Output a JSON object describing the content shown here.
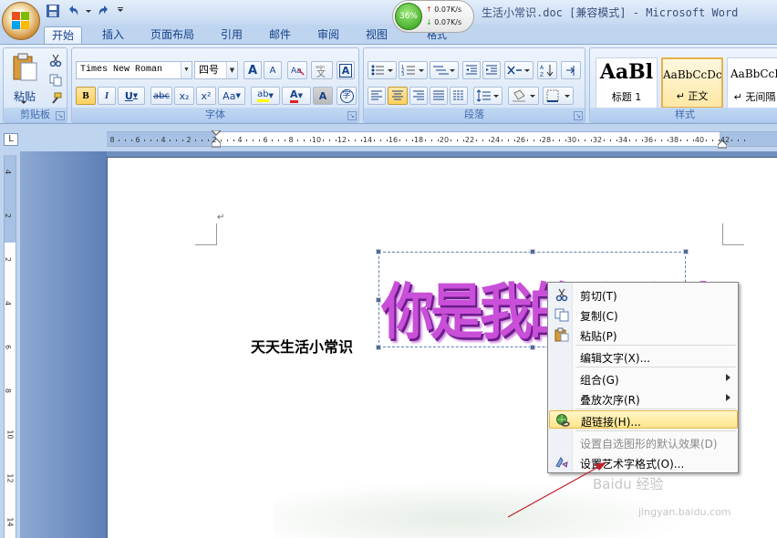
{
  "window": {
    "title": "生活小常识.doc [兼容模式] - Microsoft Word"
  },
  "network": {
    "cpu_percent": "36%",
    "upload": "0.07K/s",
    "download": "0.07K/s"
  },
  "tabs": [
    {
      "label": "开始"
    },
    {
      "label": "插入"
    },
    {
      "label": "页面布局"
    },
    {
      "label": "引用"
    },
    {
      "label": "邮件"
    },
    {
      "label": "审阅"
    },
    {
      "label": "视图"
    },
    {
      "label": "格式"
    }
  ],
  "ribbon": {
    "clipboard": {
      "paste_label": "粘贴",
      "group_label": "剪贴板"
    },
    "font": {
      "font_name": "Times New Roman",
      "font_size": "四号",
      "group_label": "字体",
      "grow": "A",
      "shrink": "A",
      "bold": "B",
      "italic": "I",
      "underline": "U",
      "strike": "abc",
      "subscript": "x₂",
      "superscript": "x²",
      "case": "Aa",
      "highlight": "ab",
      "font_color": "A",
      "char_shade": "A",
      "enclose": "字"
    },
    "paragraph": {
      "group_label": "段落"
    },
    "styles": {
      "group_label": "样式",
      "items": [
        {
          "preview": "AaBl",
          "name": "标题 1"
        },
        {
          "preview": "AaBbCcDc",
          "name": "↵ 正文"
        },
        {
          "preview": "AaBbCcI",
          "name": "↵ 无间隔"
        }
      ]
    }
  },
  "ruler": {
    "h_ticks": [
      "8",
      "6",
      "4",
      "2",
      "2",
      "4",
      "6",
      "8",
      "10",
      "12",
      "14",
      "16",
      "18",
      "20",
      "22",
      "24",
      "26",
      "28",
      "30",
      "32",
      "34",
      "36",
      "38",
      "40",
      "42"
    ],
    "v_ticks": [
      "4",
      "2",
      "2",
      "4",
      "6",
      "8",
      "10",
      "12",
      "14"
    ]
  },
  "document": {
    "body_text": "天天生活小常识",
    "wordart_text": "你是我的小小人",
    "para_mark": "↵"
  },
  "context_menu": {
    "items": [
      {
        "label": "剪切(T)",
        "icon": "scissors-icon"
      },
      {
        "label": "复制(C)",
        "icon": "copy-icon"
      },
      {
        "label": "粘贴(P)",
        "icon": "paste-icon"
      },
      {
        "label": "编辑文字(X)...",
        "icon": ""
      },
      {
        "label": "组合(G)",
        "icon": ""
      },
      {
        "label": "叠放次序(R)",
        "icon": ""
      },
      {
        "label": "超链接(H)...",
        "icon": "hyperlink-icon"
      },
      {
        "label": "设置自选图形的默认效果(D)",
        "icon": ""
      },
      {
        "label": "设置艺术字格式(O)...",
        "icon": "wordart-format-icon"
      }
    ]
  },
  "watermark": {
    "line1": "Baidu 经验",
    "line2": "jingyan.baidu.com"
  },
  "colors": {
    "ribbon_bg": "#dbe7f7",
    "wordart": "#c94fd8",
    "menu_hover": "#ffe58a",
    "arrow": "#c0202a"
  }
}
